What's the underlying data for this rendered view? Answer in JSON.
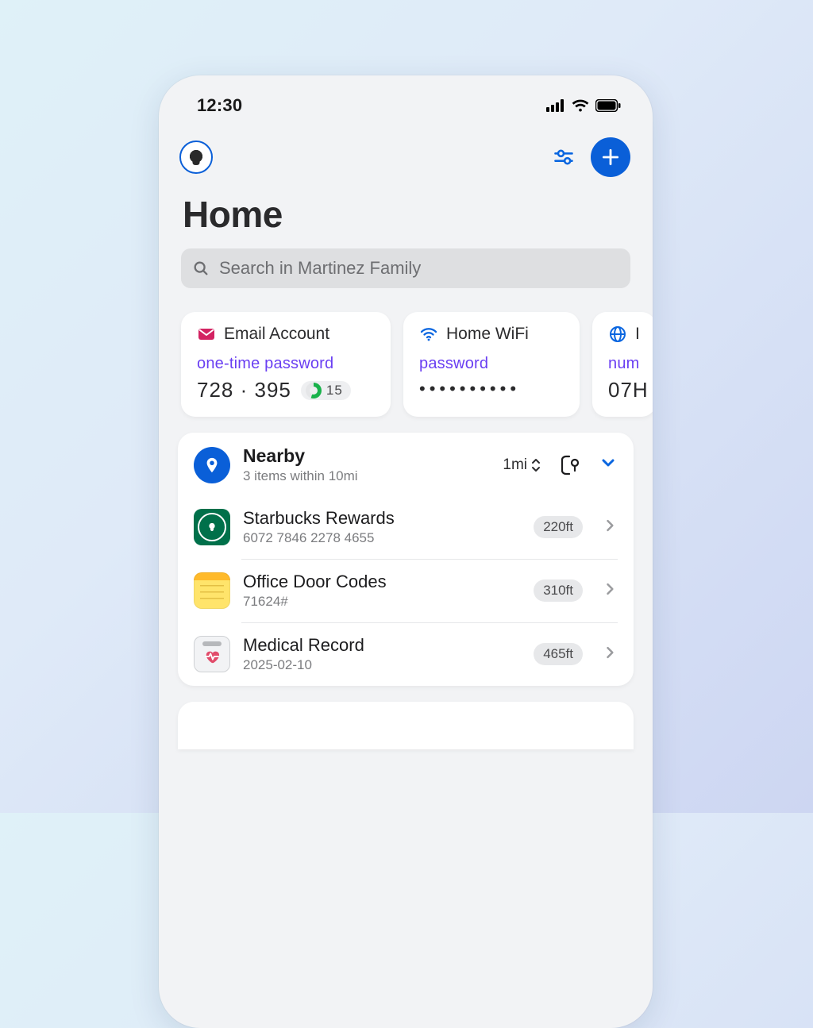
{
  "status": {
    "time": "12:30"
  },
  "header": {
    "title": "Home"
  },
  "search": {
    "placeholder": "Search in Martinez Family"
  },
  "cards": [
    {
      "icon": "mail",
      "title": "Email Account",
      "label": "one-time password",
      "value": "728 · 395",
      "countdown": "15"
    },
    {
      "icon": "wifi",
      "title": "Home WiFi",
      "label": "password",
      "value": "••••••••••"
    },
    {
      "icon": "globe",
      "title": "I",
      "label": "num",
      "value": "07H"
    }
  ],
  "nearby": {
    "title": "Nearby",
    "subtitle": "3 items within 10mi",
    "range": "1mi",
    "items": [
      {
        "title": "Starbucks Rewards",
        "subtitle": "6072 7846 2278 4655",
        "distance": "220ft"
      },
      {
        "title": "Office Door Codes",
        "subtitle": "71624#",
        "distance": "310ft"
      },
      {
        "title": "Medical Record",
        "subtitle": "2025-02-10",
        "distance": "465ft"
      }
    ]
  }
}
